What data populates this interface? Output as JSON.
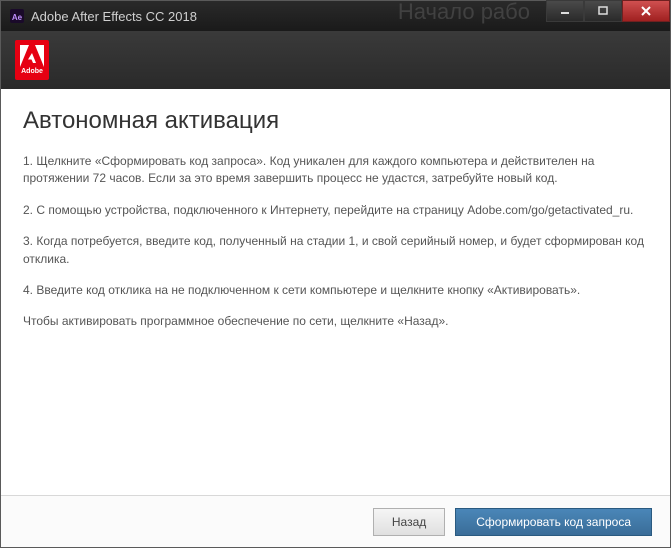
{
  "titlebar": {
    "title": "Adobe After Effects CC 2018",
    "ghost_text": "Начало рабо"
  },
  "logo": {
    "brand": "Adobe"
  },
  "content": {
    "heading": "Автономная активация",
    "p1": "1. Щелкните «Сформировать код запроса». Код уникален для каждого компьютера и действителен на протяжении 72 часов. Если за это время завершить процесс не удастся, затребуйте новый код.",
    "p2": "2. С помощью устройства, подключенного к Интернету, перейдите на страницу Adobe.com/go/getactivated_ru.",
    "p3": "3. Когда потребуется, введите код, полученный на стадии 1, и свой серийный номер, и будет сформирован код отклика.",
    "p4": "4. Введите код отклика на не подключенном к сети компьютере и щелкните кнопку «Активировать».",
    "p5": "Чтобы активировать программное обеспечение по сети, щелкните «Назад»."
  },
  "footer": {
    "back_label": "Назад",
    "generate_label": "Сформировать код запроса"
  }
}
